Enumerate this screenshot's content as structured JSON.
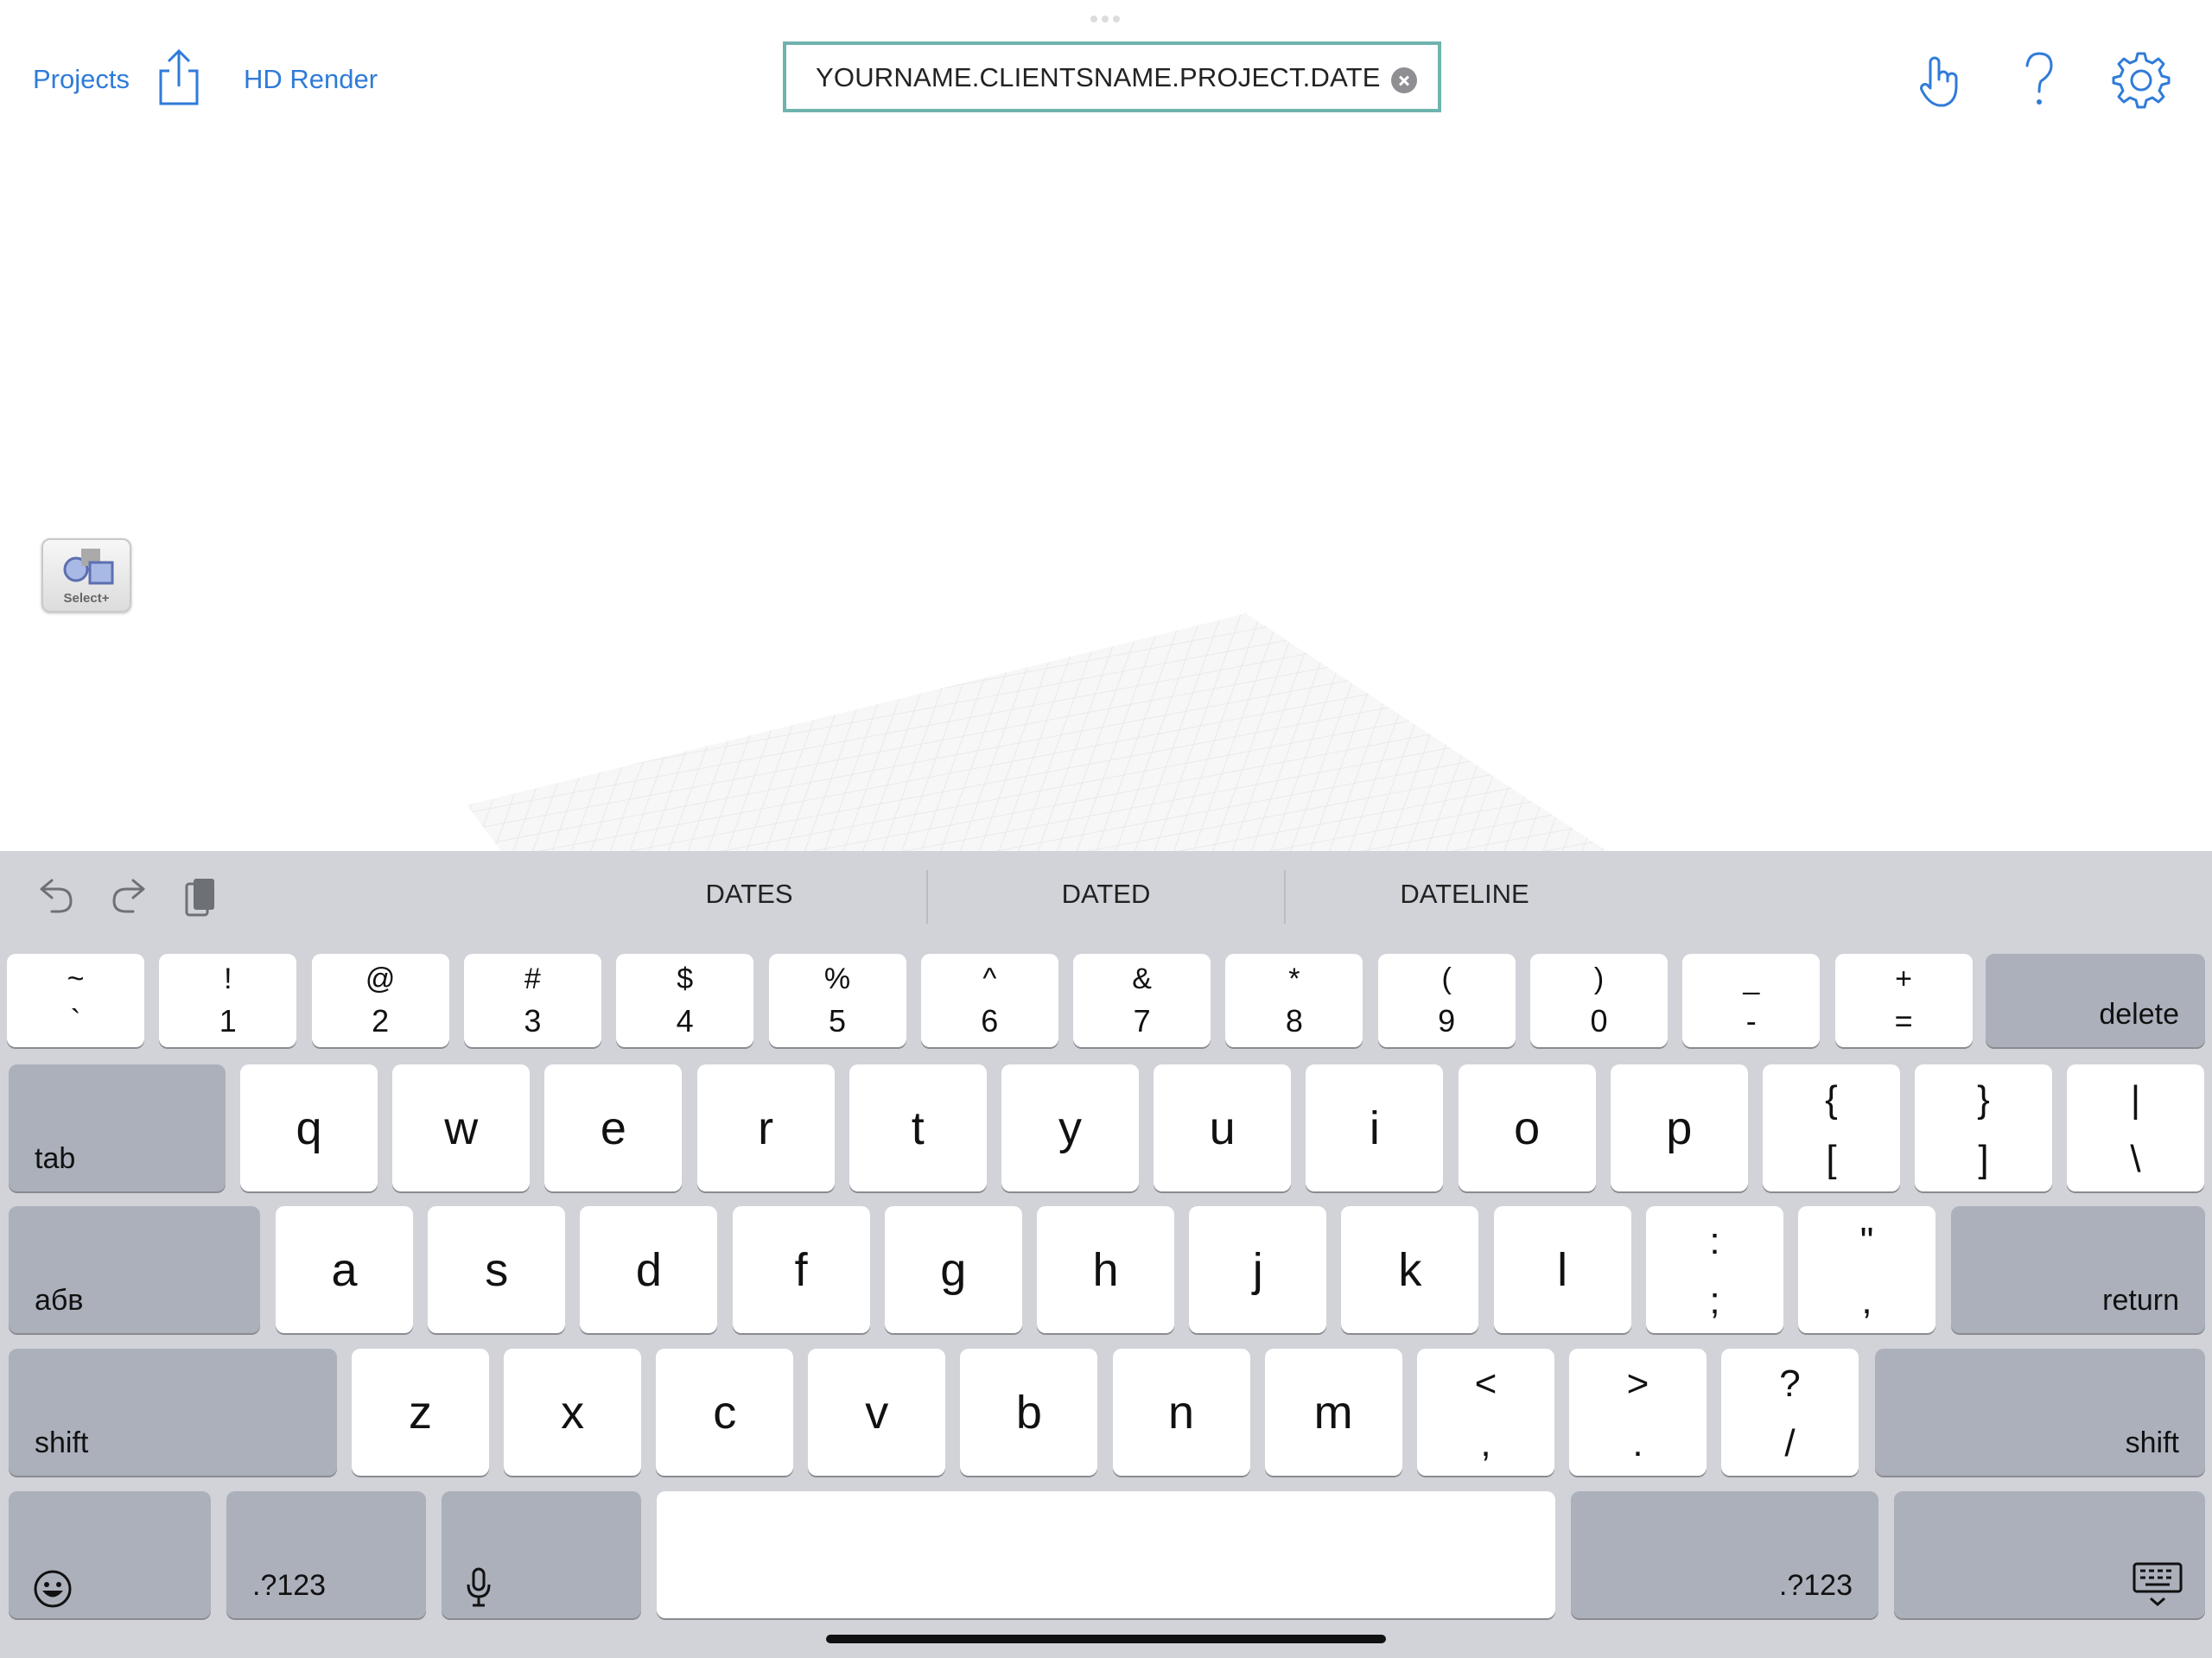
{
  "toolbar": {
    "projects_label": "Projects",
    "hd_render_label": "HD Render",
    "title_value": "YOURNAME.CLIENTSNAME.PROJECT.DATE"
  },
  "canvas": {
    "select_tool_label": "Select+"
  },
  "colors": {
    "accent": "#2f7bd9",
    "title_field_border": "#6fb3ad",
    "keyboard_bg": "#d1d3d9",
    "dark_key": "#abb0bb"
  },
  "keyboard": {
    "suggestions": [
      "DATES",
      "DATED",
      "DATELINE"
    ],
    "row1": [
      {
        "top": "~",
        "bot": "`"
      },
      {
        "top": "!",
        "bot": "1"
      },
      {
        "top": "@",
        "bot": "2"
      },
      {
        "top": "#",
        "bot": "3"
      },
      {
        "top": "$",
        "bot": "4"
      },
      {
        "top": "%",
        "bot": "5"
      },
      {
        "top": "^",
        "bot": "6"
      },
      {
        "top": "&",
        "bot": "7"
      },
      {
        "top": "*",
        "bot": "8"
      },
      {
        "top": "(",
        "bot": "9"
      },
      {
        "top": ")",
        "bot": "0"
      },
      {
        "top": "_",
        "bot": "-"
      },
      {
        "top": "+",
        "bot": "="
      }
    ],
    "delete_label": "delete",
    "tab_label": "tab",
    "row2": [
      "q",
      "w",
      "e",
      "r",
      "t",
      "y",
      "u",
      "i",
      "o",
      "p"
    ],
    "row2_sym": [
      {
        "top": "{",
        "bot": "["
      },
      {
        "top": "}",
        "bot": "]"
      },
      {
        "top": "|",
        "bot": "\\"
      }
    ],
    "lang_label": "абв",
    "row3": [
      "a",
      "s",
      "d",
      "f",
      "g",
      "h",
      "j",
      "k",
      "l"
    ],
    "row3_sym": [
      {
        "top": ":",
        "bot": ";"
      },
      {
        "top": "\"",
        "bot": ","
      }
    ],
    "return_label": "return",
    "shift_label": "shift",
    "row4": [
      "z",
      "x",
      "c",
      "v",
      "b",
      "n",
      "m"
    ],
    "row4_sym": [
      {
        "top": "<",
        "bot": ","
      },
      {
        "top": ">",
        "bot": "."
      },
      {
        "top": "?",
        "bot": "/"
      }
    ],
    "numbers_label": ".?123"
  }
}
